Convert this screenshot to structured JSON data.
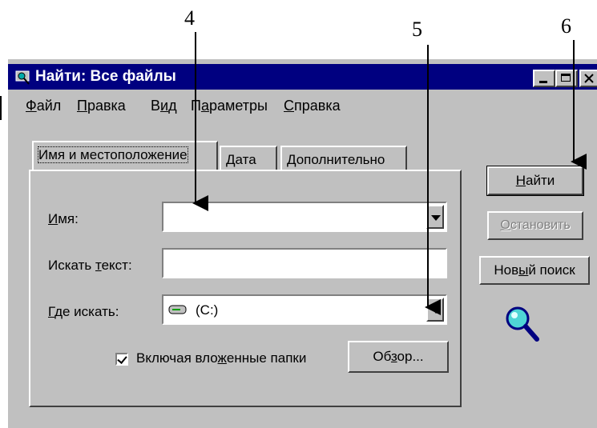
{
  "callouts": {
    "c4": "4",
    "c5": "5",
    "c6": "6"
  },
  "window": {
    "title": "Найти: Все файлы"
  },
  "menu": {
    "file": {
      "hot": "Ф",
      "rest": "айл"
    },
    "edit": {
      "hot": "П",
      "rest": "равка"
    },
    "view_a": {
      "text": "В"
    },
    "view_hot": "и",
    "view_b": "д",
    "params": {
      "pre": "П",
      "hot": "а",
      "rest": "раметры"
    },
    "help": {
      "hot": "С",
      "rest": "правка"
    }
  },
  "tabs": {
    "name_location": "Имя и местоположение",
    "date": "Дата",
    "advanced": "Дополнительно"
  },
  "form": {
    "name_label_hot": "И",
    "name_label_rest": "мя:",
    "text_label_a": "Искать ",
    "text_label_hot": "т",
    "text_label_b": "екст:",
    "where_label_hot": "Г",
    "where_label_rest": "де искать:",
    "name_value": "",
    "text_value": "",
    "where_value": "(C:)",
    "include_a": "Включая вло",
    "include_hot": "ж",
    "include_b": "енные папки",
    "include_checked": true,
    "browse_a": "Об",
    "browse_hot": "з",
    "browse_b": "ор..."
  },
  "buttons": {
    "find_hot": "Н",
    "find_rest": "айти",
    "stop_hot": "О",
    "stop_rest": "становить",
    "new_a": "Нов",
    "new_hot": "ы",
    "new_b": "й поиск"
  },
  "icons": {
    "window": "search-window-icon",
    "drive": "hard-drive-icon",
    "magnifier": "magnifier-icon"
  }
}
